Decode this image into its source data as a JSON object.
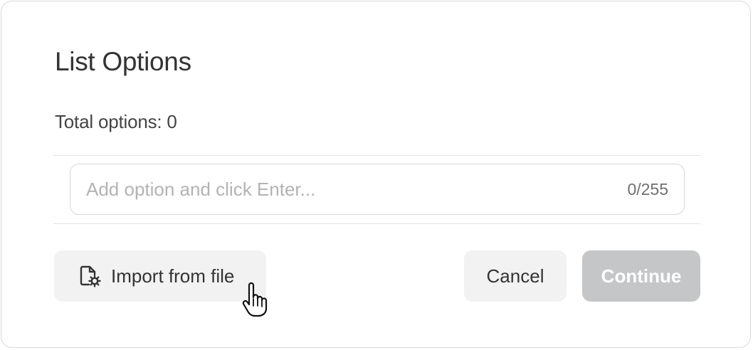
{
  "dialog": {
    "title": "List Options",
    "total_options": "Total options: 0",
    "input": {
      "placeholder": "Add option and click Enter...",
      "value": "",
      "counter": "0/255"
    },
    "buttons": {
      "import_label": "Import from file",
      "cancel_label": "Cancel",
      "continue_label": "Continue"
    },
    "icons": {
      "import": "file-settings-icon",
      "cursor": "hand-pointer-cursor"
    },
    "colors": {
      "continue_disabled_bg": "#c4c6c8",
      "secondary_bg": "#f2f2f2",
      "text": "#333333"
    }
  }
}
